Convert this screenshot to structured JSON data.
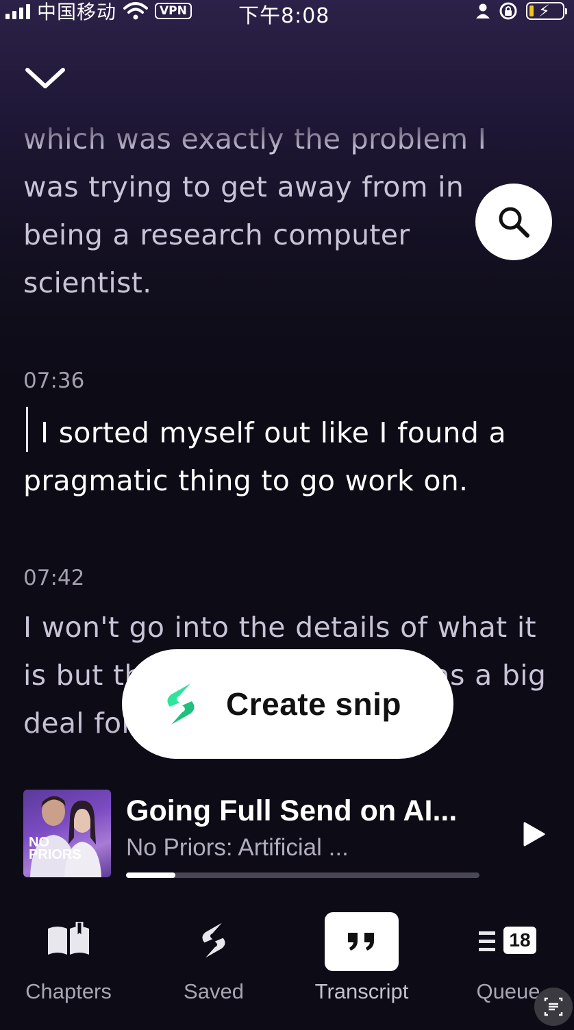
{
  "status_bar": {
    "carrier": "中国移动",
    "vpn": "VPN",
    "time": "下午8:08"
  },
  "transcript": {
    "segments": [
      {
        "timestamp": "",
        "text": "which was exactly the problem I was trying to get away from in being a research computer scientist."
      },
      {
        "timestamp": "07:36",
        "text": "I sorted myself out like I found a pragmatic thing to go work on."
      },
      {
        "timestamp": "07:42",
        "text": "I won't go into the details of what it is but the Google ... which was a big deal for solving this very sort"
      }
    ]
  },
  "buttons": {
    "create_snip": "Create snip"
  },
  "player": {
    "episode_title": "Going Full Send on AI...",
    "show_name": "No Priors: Artificial ...",
    "artwork_text": "NO PRIORS",
    "progress": 0.14
  },
  "nav": {
    "chapters": "Chapters",
    "saved": "Saved",
    "transcript": "Transcript",
    "queue": "Queue",
    "queue_count": "18"
  },
  "colors": {
    "background": "#0d0b16",
    "gradient_top": "#2c2148",
    "snip_accent": "#2ee59d"
  }
}
